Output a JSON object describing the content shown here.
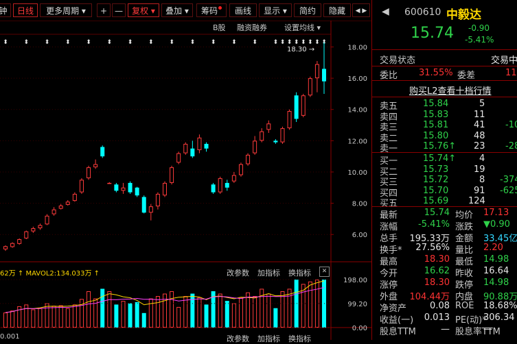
{
  "toolbar": {
    "items": [
      {
        "label": "钟"
      },
      {
        "label": "日线"
      },
      {
        "label": "更多周期 ▾"
      },
      {
        "label": "+"
      },
      {
        "label": "—"
      },
      {
        "label": "复权 ▾"
      },
      {
        "label": "叠加 ▾"
      },
      {
        "label": "筹码"
      },
      {
        "label": "画线"
      },
      {
        "label": "显示 ▾"
      },
      {
        "label": "简约"
      },
      {
        "label": "隐藏"
      },
      {
        "label": "◀ ▶"
      }
    ]
  },
  "chart_header": {
    "b_stock": "B股",
    "margin_trading": "融资融券",
    "set_ma": "设置均线 ▾"
  },
  "price_axis": [
    "18.00",
    "16.00",
    "14.00",
    "12.00",
    "10.00",
    "8.00",
    "6.00"
  ],
  "high_marker": "18.30 →",
  "volume_header": {
    "indicator_text": "62万 ↑ MAVOL2:134.033万 ↑",
    "change_params": "改参数",
    "add_indicator": "加指标",
    "switch_indicator": "换指标",
    "close": "✕"
  },
  "volume_axis": [
    "198.00",
    "99.20",
    "0.00"
  ],
  "bottom_row": {
    "text1": "0.001",
    "text2": "改参数",
    "text3": "加指标",
    "text4": "换指标"
  },
  "chart_data": {
    "type": "candlestick",
    "price_ylim": [
      5.0,
      18.9
    ],
    "candles": [
      {
        "o": 5.05,
        "c": 5.25,
        "h": 5.3,
        "l": 4.95
      },
      {
        "o": 5.2,
        "c": 5.45,
        "h": 5.5,
        "l": 5.15
      },
      {
        "o": 5.4,
        "c": 5.7,
        "h": 5.75,
        "l": 5.35
      },
      {
        "o": 5.75,
        "c": 6.2,
        "h": 6.25,
        "l": 5.7
      },
      {
        "o": 6.2,
        "c": 6.4,
        "h": 6.5,
        "l": 6.1
      },
      {
        "o": 6.4,
        "c": 6.6,
        "h": 6.7,
        "l": 6.3
      },
      {
        "o": 6.65,
        "c": 7.2,
        "h": 7.3,
        "l": 6.6
      },
      {
        "o": 7.3,
        "c": 7.6,
        "h": 7.75,
        "l": 7.2
      },
      {
        "o": 7.65,
        "c": 7.85,
        "h": 7.95,
        "l": 7.6
      },
      {
        "o": 7.9,
        "c": 8.1,
        "h": 8.2,
        "l": 7.85
      },
      {
        "o": 8.15,
        "c": 8.6,
        "h": 8.7,
        "l": 8.1
      },
      {
        "o": 8.7,
        "c": 9.5,
        "h": 9.6,
        "l": 8.6
      },
      {
        "o": 9.6,
        "c": 10.3,
        "h": 10.4,
        "l": 9.5
      },
      {
        "o": 10.3,
        "c": 10.5,
        "h": 10.8,
        "l": 10.2
      },
      {
        "o": 11.6,
        "c": 11.0,
        "h": 11.7,
        "l": 10.9
      },
      {
        "o": 9.3,
        "c": 9.3,
        "h": 9.35,
        "l": 9.25
      },
      {
        "o": 9.2,
        "c": 8.8,
        "h": 9.3,
        "l": 8.7
      },
      {
        "o": 8.8,
        "c": 9.0,
        "h": 9.3,
        "l": 8.6
      },
      {
        "o": 9.3,
        "c": 8.7,
        "h": 9.4,
        "l": 8.6
      },
      {
        "o": 9.0,
        "c": 8.5,
        "h": 9.05,
        "l": 8.4
      },
      {
        "o": 8.4,
        "c": 7.4,
        "h": 8.5,
        "l": 7.35
      },
      {
        "o": 7.4,
        "c": 7.8,
        "h": 7.95,
        "l": 6.9
      },
      {
        "o": 7.8,
        "c": 8.6,
        "h": 8.7,
        "l": 7.6
      },
      {
        "o": 8.5,
        "c": 9.3,
        "h": 9.4,
        "l": 8.4
      },
      {
        "o": 9.3,
        "c": 10.3,
        "h": 10.4,
        "l": 9.2
      },
      {
        "o": 10.6,
        "c": 11.2,
        "h": 11.3,
        "l": 10.5
      },
      {
        "o": 11.2,
        "c": 11.8,
        "h": 11.9,
        "l": 11.1
      },
      {
        "o": 11.5,
        "c": 11.0,
        "h": 12.0,
        "l": 10.9
      },
      {
        "o": 11.4,
        "c": 12.2,
        "h": 12.4,
        "l": 11.2
      },
      {
        "o": 11.8,
        "c": 11.5,
        "h": 11.9,
        "l": 11.3
      },
      {
        "o": 9.2,
        "c": 8.7,
        "h": 9.3,
        "l": 8.6
      },
      {
        "o": 8.7,
        "c": 9.6,
        "h": 9.7,
        "l": 8.6
      },
      {
        "o": 9.3,
        "c": 9.0,
        "h": 9.5,
        "l": 8.8
      },
      {
        "o": 9.4,
        "c": 9.8,
        "h": 10.0,
        "l": 9.3
      },
      {
        "o": 9.8,
        "c": 10.5,
        "h": 10.6,
        "l": 9.7
      },
      {
        "o": 10.5,
        "c": 11.1,
        "h": 11.2,
        "l": 10.4
      },
      {
        "o": 11.2,
        "c": 12.0,
        "h": 12.3,
        "l": 11.1
      },
      {
        "o": 12.0,
        "c": 12.6,
        "h": 12.8,
        "l": 11.9
      },
      {
        "o": 12.7,
        "c": 13.1,
        "h": 13.3,
        "l": 12.5
      },
      {
        "o": 12.0,
        "c": 11.9,
        "h": 12.1,
        "l": 11.8
      },
      {
        "o": 11.9,
        "c": 12.8,
        "h": 12.9,
        "l": 11.8
      },
      {
        "o": 12.8,
        "c": 13.9,
        "h": 14.0,
        "l": 12.7
      },
      {
        "o": 14.9,
        "c": 13.4,
        "h": 15.1,
        "l": 13.2
      },
      {
        "o": 13.6,
        "c": 14.9,
        "h": 15.0,
        "l": 13.5
      },
      {
        "o": 14.9,
        "c": 16.0,
        "h": 16.1,
        "l": 14.8
      },
      {
        "o": 16.0,
        "c": 16.9,
        "h": 17.1,
        "l": 15.1
      },
      {
        "o": 16.6,
        "c": 15.8,
        "h": 18.3,
        "l": 15.0
      }
    ],
    "volume_ylim": [
      0,
      198
    ],
    "volumes": [
      62,
      70,
      88,
      95,
      75,
      80,
      100,
      90,
      92,
      80,
      95,
      118,
      150,
      120,
      160,
      150,
      95,
      110,
      100,
      105,
      60,
      120,
      130,
      140,
      150,
      85,
      130,
      140,
      125,
      95,
      150,
      140,
      110,
      100,
      125,
      145,
      130,
      160,
      140,
      80,
      150,
      160,
      198,
      180,
      190,
      198,
      198
    ],
    "ma_lines": {
      "color1": "#ffd800",
      "color2": "#ff40ff"
    }
  },
  "quote": {
    "code": "600610",
    "name": "中毅达",
    "price": "15.74",
    "change": "-0.90",
    "change_pct": "-5.41%",
    "trade_status_label": "交易状态",
    "trade_status_value": "交易中",
    "weibi_label": "委比",
    "weibi_value": "31.55%",
    "weicha_label": "委差",
    "weicha_value": "118",
    "l2_link": "购买L2查看十档行情"
  },
  "order_book": {
    "asks": [
      {
        "label": "卖五",
        "price": "15.84",
        "vol": "5",
        "chg": ""
      },
      {
        "label": "卖四",
        "price": "15.83",
        "vol": "11",
        "chg": ""
      },
      {
        "label": "卖三",
        "price": "15.81",
        "vol": "41",
        "chg": "-10"
      },
      {
        "label": "卖二",
        "price": "15.80",
        "vol": "48",
        "chg": ""
      },
      {
        "label": "卖一",
        "price": "15.76↑",
        "vol": "23",
        "chg": "-28"
      }
    ],
    "bids": [
      {
        "label": "买一",
        "price": "15.74↑",
        "vol": "4",
        "chg": ""
      },
      {
        "label": "买二",
        "price": "15.73",
        "vol": "19",
        "chg": ""
      },
      {
        "label": "买三",
        "price": "15.72",
        "vol": "8",
        "chg": "-374"
      },
      {
        "label": "买四",
        "price": "15.70",
        "vol": "91",
        "chg": "-625"
      },
      {
        "label": "买五",
        "price": "15.69",
        "vol": "124",
        "chg": ""
      }
    ]
  },
  "stats": [
    {
      "l1": "最新",
      "v1": "15.74",
      "c1": "green",
      "l2": "均价",
      "v2": "17.13",
      "c2": "red"
    },
    {
      "l1": "涨幅",
      "v1": "-5.41%",
      "c1": "green",
      "l2": "涨跌",
      "v2": "▼0.90",
      "c2": "green"
    },
    {
      "l1": "总手",
      "v1": "195.33万",
      "c1": "white",
      "l2": "金额",
      "v2": "33.45亿",
      "c2": "cyan"
    },
    {
      "l1": "换手*",
      "v1": "27.56%",
      "c1": "white",
      "l2": "量比",
      "v2": "2.20",
      "c2": "red"
    },
    {
      "l1": "最高",
      "v1": "18.30",
      "c1": "red",
      "l2": "最低",
      "v2": "14.98",
      "c2": "green"
    },
    {
      "l1": "今开",
      "v1": "16.62",
      "c1": "green",
      "l2": "昨收",
      "v2": "16.64",
      "c2": "white"
    },
    {
      "l1": "涨停",
      "v1": "18.30",
      "c1": "red",
      "l2": "跌停",
      "v2": "14.98",
      "c2": "green"
    },
    {
      "l1": "外盘",
      "v1": "104.44万",
      "c1": "red",
      "l2": "内盘",
      "v2": "90.88万",
      "c2": "green"
    },
    {
      "l1": "净资产",
      "v1": "0.08",
      "c1": "white",
      "l2": "ROE",
      "v2": "18.68%",
      "c2": "white"
    },
    {
      "l1": "收益(一)",
      "v1": "0.013",
      "c1": "white",
      "l2": "PE(动)*",
      "v2": "306.34",
      "c2": "white"
    },
    {
      "l1": "股息TTM",
      "v1": "—",
      "c1": "white",
      "l2": "股息率TTM",
      "v2": "—",
      "c2": "white"
    }
  ]
}
